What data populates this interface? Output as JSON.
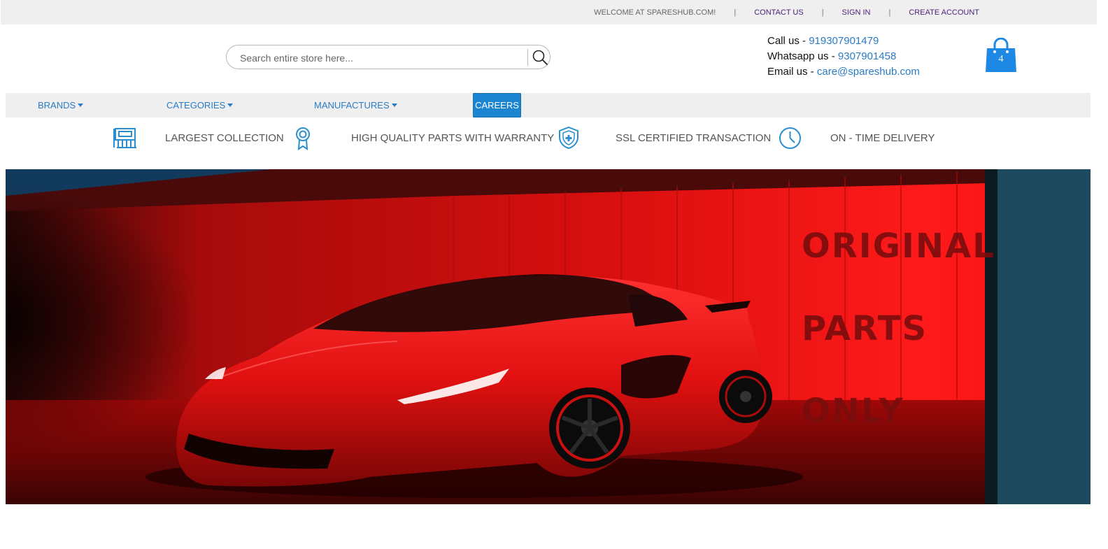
{
  "topbar": {
    "welcome": "WELCOME AT SPARESHUB.COM!",
    "separator": "|",
    "contact_us": "CONTACT US",
    "sign_in": "SIGN IN",
    "create_account": "CREATE ACCOUNT"
  },
  "search": {
    "placeholder": "Search entire store here...",
    "value": ""
  },
  "contact": {
    "call_label": "Call us - ",
    "call_value": "919307901479",
    "whatsapp_label": "Whatsapp us - ",
    "whatsapp_value": "9307901458",
    "email_label": "Email us - ",
    "email_value": "care@spareshub.com"
  },
  "cart": {
    "count": "4",
    "icon": "shopping-bag-icon"
  },
  "nav": {
    "brands": "BRANDS",
    "categories": "CATEGORIES",
    "manufactures": "MANUFACTURES",
    "careers": "CAREERS"
  },
  "features": [
    {
      "label": "LARGEST COLLECTION",
      "icon": "parts-collection-icon"
    },
    {
      "label": "HIGH QUALITY PARTS WITH WARRANTY",
      "icon": "award-ribbon-icon"
    },
    {
      "label": "SSL CERTIFIED TRANSACTION",
      "icon": "shield-icon"
    },
    {
      "label": "ON - TIME DELIVERY",
      "icon": "clock-icon"
    }
  ],
  "hero": {
    "line1": "ORIGINAL",
    "line2": "PARTS",
    "line3": "ONLY"
  },
  "colors": {
    "accent_blue": "#2a7cc7",
    "careers_bg": "#1c85d1",
    "topbar_bg": "#efefef",
    "topbar_link": "#4a1f78",
    "hero_red": "#e01010"
  }
}
